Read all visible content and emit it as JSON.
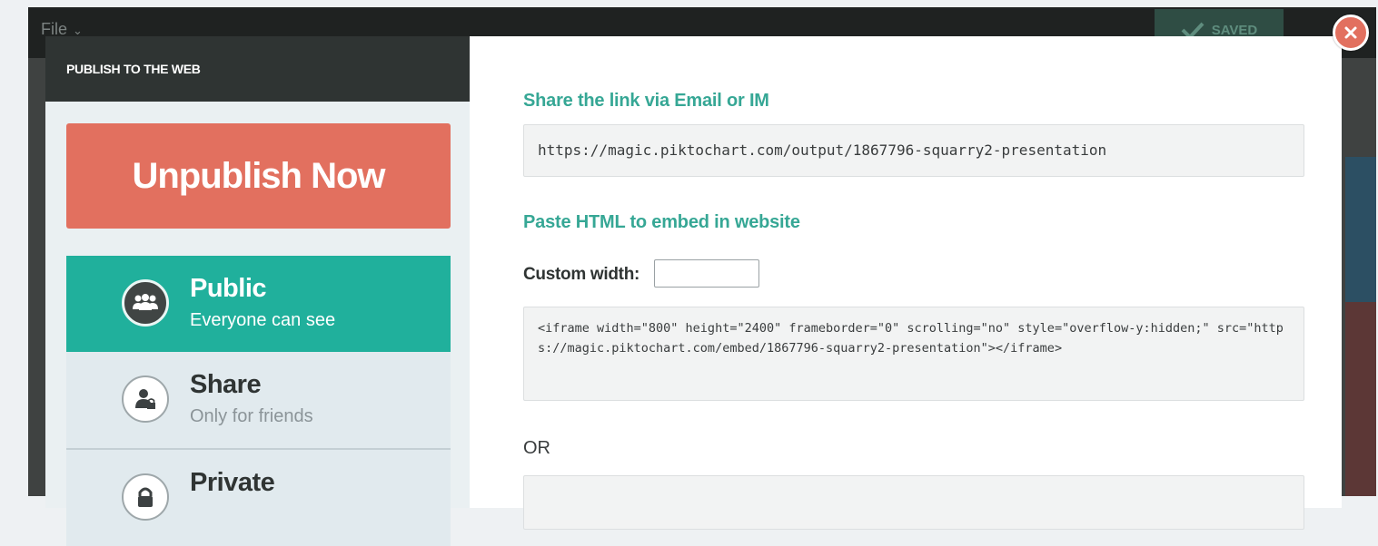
{
  "app": {
    "file_menu": "File",
    "saved_label": "SAVED"
  },
  "modal": {
    "header_title": "PUBLISH TO THE WEB",
    "unpublish_label": "Unpublish Now",
    "options": [
      {
        "title": "Public",
        "subtitle": "Everyone can see",
        "icon": "group-icon",
        "selected": true
      },
      {
        "title": "Share",
        "subtitle": "Only for friends",
        "icon": "user-lock-icon",
        "selected": false
      },
      {
        "title": "Private",
        "subtitle": "",
        "icon": "lock-icon",
        "selected": false
      }
    ],
    "share_link_title": "Share the link via Email or IM",
    "share_link_url": "https://magic.piktochart.com/output/1867796-squarry2-presentation",
    "embed_title": "Paste HTML to embed in website",
    "custom_width_label": "Custom width:",
    "custom_width_value": "",
    "embed_code": "<iframe width=\"800\" height=\"2400\" frameborder=\"0\" scrolling=\"no\" style=\"overflow-y:hidden;\" src=\"https://magic.piktochart.com/embed/1867796-squarry2-presentation\"></iframe>",
    "or_label": "OR"
  },
  "colors": {
    "accent_teal": "#20b09c",
    "unpublish_red": "#e2705f",
    "header_dark": "#2f3433",
    "section_title": "#36a795"
  }
}
